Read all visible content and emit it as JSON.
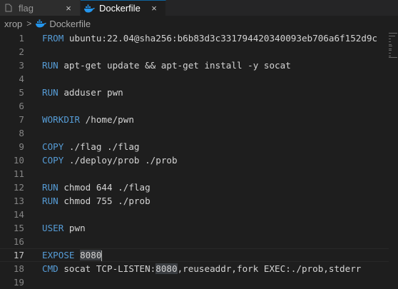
{
  "tabs": [
    {
      "label": "flag",
      "close": "×",
      "icon": "file-text-icon"
    },
    {
      "label": "Dockerfile",
      "close": "×",
      "icon": "docker-whale-icon",
      "active": true
    }
  ],
  "breadcrumb": {
    "folder": "xrop",
    "separator": ">",
    "file": "Dockerfile",
    "file_icon": "docker-whale-icon"
  },
  "colors": {
    "keyword": "#569cd6",
    "text": "#d4d4d4",
    "line_number": "#858585",
    "background": "#1e1e1e"
  },
  "editor": {
    "lines": [
      {
        "n": "1",
        "kw": "FROM",
        "rest": " ubuntu:22.04@sha256:b6b83d3c331794420340093eb706a6f152d9c"
      },
      {
        "n": "2",
        "kw": "",
        "rest": ""
      },
      {
        "n": "3",
        "kw": "RUN",
        "rest": " apt-get update && apt-get install -y socat"
      },
      {
        "n": "4",
        "kw": "",
        "rest": ""
      },
      {
        "n": "5",
        "kw": "RUN",
        "rest": " adduser pwn"
      },
      {
        "n": "6",
        "kw": "",
        "rest": ""
      },
      {
        "n": "7",
        "kw": "WORKDIR",
        "rest": " /home/pwn"
      },
      {
        "n": "8",
        "kw": "",
        "rest": ""
      },
      {
        "n": "9",
        "kw": "COPY",
        "rest": " ./flag ./flag"
      },
      {
        "n": "10",
        "kw": "COPY",
        "rest": " ./deploy/prob ./prob"
      },
      {
        "n": "11",
        "kw": "",
        "rest": ""
      },
      {
        "n": "12",
        "kw": "RUN",
        "rest": " chmod 644 ./flag"
      },
      {
        "n": "13",
        "kw": "RUN",
        "rest": " chmod 755 ./prob"
      },
      {
        "n": "14",
        "kw": "",
        "rest": ""
      },
      {
        "n": "15",
        "kw": "USER",
        "rest": " pwn"
      },
      {
        "n": "16",
        "kw": "",
        "rest": ""
      },
      {
        "n": "17",
        "kw": "EXPOSE",
        "rest": " ",
        "highlight": "8080",
        "after": "",
        "current": true
      },
      {
        "n": "18",
        "kw": "CMD",
        "rest": " socat TCP-LISTEN:",
        "highlight": "8080",
        "after": ",reuseaddr,fork EXEC:./prob,stderr"
      },
      {
        "n": "19",
        "kw": "",
        "rest": ""
      }
    ]
  }
}
